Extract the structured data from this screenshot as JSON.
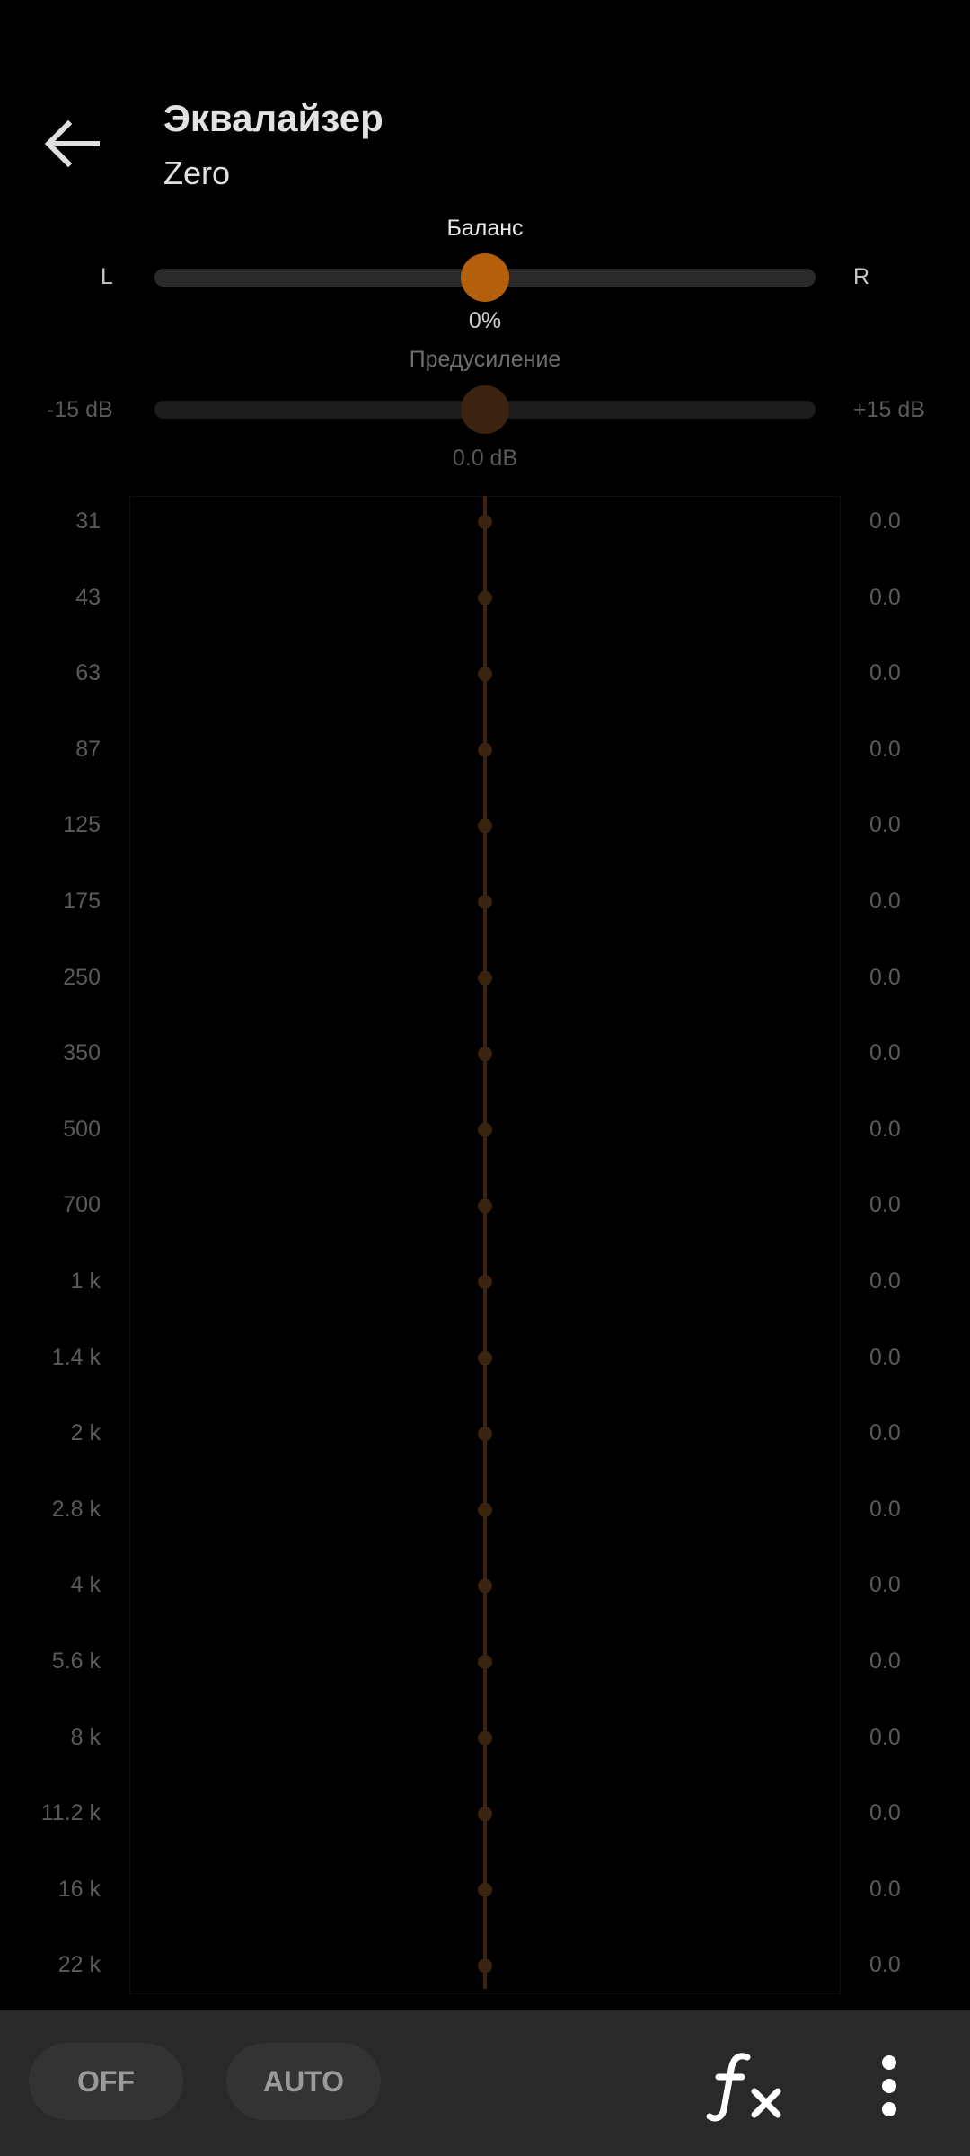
{
  "header": {
    "title": "Эквалайзер",
    "subtitle": "Zero"
  },
  "balance": {
    "title": "Баланс",
    "left_label": "L",
    "right_label": "R",
    "value": "0%",
    "level": 0.5
  },
  "preamp": {
    "title": "Предусиление",
    "min_label": "-15 dB",
    "max_label": "+15 dB",
    "value": "0.0 dB",
    "level": 0.5
  },
  "eq": {
    "bands": [
      {
        "freq": "31",
        "gain": "0.0"
      },
      {
        "freq": "43",
        "gain": "0.0"
      },
      {
        "freq": "63",
        "gain": "0.0"
      },
      {
        "freq": "87",
        "gain": "0.0"
      },
      {
        "freq": "125",
        "gain": "0.0"
      },
      {
        "freq": "175",
        "gain": "0.0"
      },
      {
        "freq": "250",
        "gain": "0.0"
      },
      {
        "freq": "350",
        "gain": "0.0"
      },
      {
        "freq": "500",
        "gain": "0.0"
      },
      {
        "freq": "700",
        "gain": "0.0"
      },
      {
        "freq": "1 k",
        "gain": "0.0"
      },
      {
        "freq": "1.4 k",
        "gain": "0.0"
      },
      {
        "freq": "2 k",
        "gain": "0.0"
      },
      {
        "freq": "2.8 k",
        "gain": "0.0"
      },
      {
        "freq": "4 k",
        "gain": "0.0"
      },
      {
        "freq": "5.6 k",
        "gain": "0.0"
      },
      {
        "freq": "8 k",
        "gain": "0.0"
      },
      {
        "freq": "11.2 k",
        "gain": "0.0"
      },
      {
        "freq": "16 k",
        "gain": "0.0"
      },
      {
        "freq": "22 k",
        "gain": "0.0"
      }
    ]
  },
  "bottom_bar": {
    "off_label": "OFF",
    "auto_label": "AUTO"
  },
  "icons": {
    "back": "arrow-left-icon",
    "fx": "fx-icon",
    "more": "more-vertical-icon"
  },
  "colors": {
    "accent": "#b35f0b",
    "accent_dim": "#3a2410",
    "background": "#000000",
    "bar": "#292929"
  }
}
